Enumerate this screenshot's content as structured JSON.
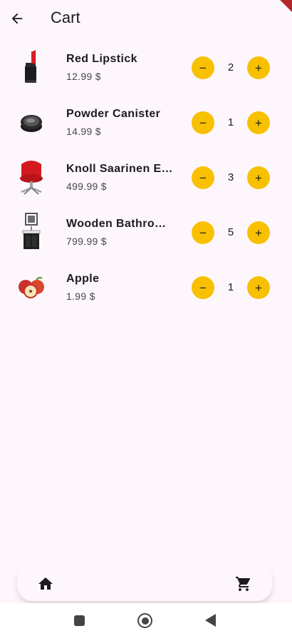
{
  "app_bar": {
    "title": "Cart"
  },
  "cart": {
    "items": [
      {
        "name": "Red Lipstick",
        "price": "12.99 $",
        "quantity": "2",
        "image": "lipstick-image"
      },
      {
        "name": "Powder Canister",
        "price": "14.99 $",
        "quantity": "1",
        "image": "powder-canister-image"
      },
      {
        "name": "Knoll Saarinen Executive Conference Chair",
        "price": "499.99 $",
        "quantity": "3",
        "image": "chair-image"
      },
      {
        "name": "Wooden Bathroom Sink With Mirror",
        "price": "799.99 $",
        "quantity": "5",
        "image": "sink-image"
      },
      {
        "name": "Apple",
        "price": "1.99 $",
        "quantity": "1",
        "image": "apple-image"
      }
    ],
    "minus_label": "−",
    "plus_label": "+"
  },
  "bottom_nav": {
    "items": [
      "home-icon",
      "cart-icon"
    ]
  },
  "colors": {
    "background": "#fdf7fd",
    "accent": "#f8c000"
  }
}
